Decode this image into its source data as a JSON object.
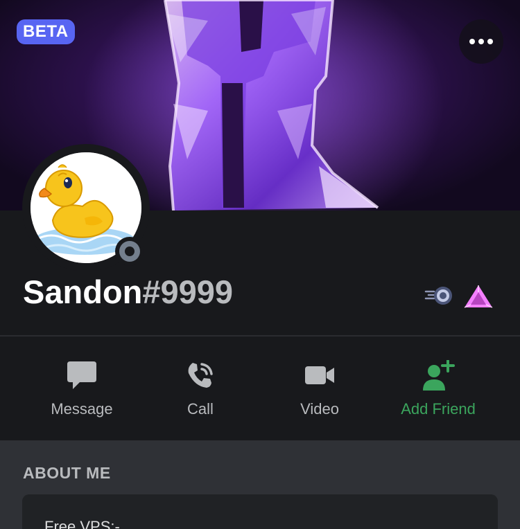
{
  "profile": {
    "beta_label": "BETA",
    "username": "Sandon",
    "discriminator": "#9999",
    "status": "offline"
  },
  "icons": {
    "more": "more-horizontal-icon",
    "nitro_badge": "nitro-badge-icon",
    "boost_badge": "server-boost-badge-icon",
    "avatar": "duck-avatar"
  },
  "actions": [
    {
      "label": "Message",
      "icon": "chat-bubble-icon"
    },
    {
      "label": "Call",
      "icon": "phone-call-icon"
    },
    {
      "label": "Video",
      "icon": "video-camera-icon"
    },
    {
      "label": "Add Friend",
      "icon": "add-friend-icon"
    }
  ],
  "about": {
    "title": "ABOUT ME",
    "text": "Free VPS:-"
  },
  "colors": {
    "banner_purple": "#4a1f86",
    "beta_badge": "#5865f2",
    "add_friend_green": "#3ba55d",
    "header_bg": "#18191c",
    "page_bg": "#2f3136",
    "card_bg": "#202225"
  }
}
